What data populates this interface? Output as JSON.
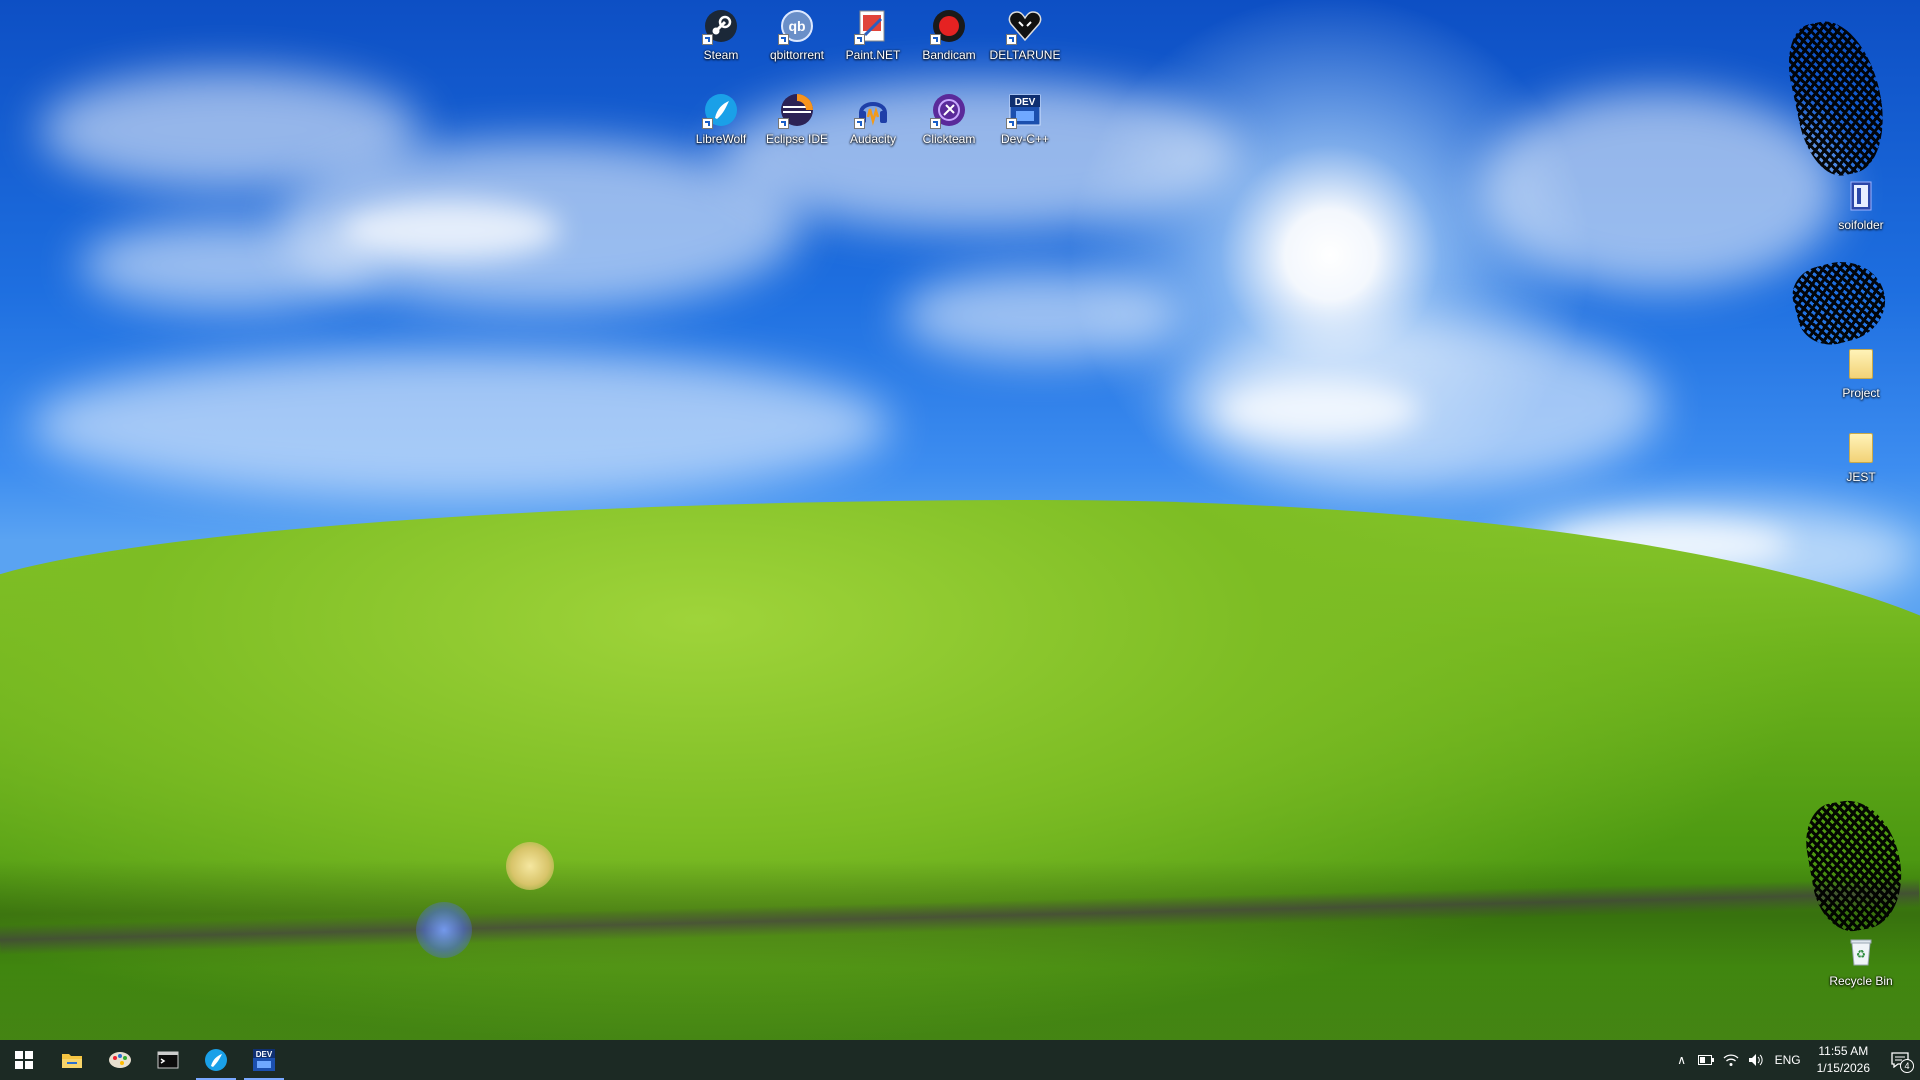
{
  "desktop": {
    "icons": [
      {
        "label": "Steam"
      },
      {
        "label": "qbittorrent"
      },
      {
        "label": "Paint.NET"
      },
      {
        "label": "Bandicam"
      },
      {
        "label": "DELTARUNE"
      },
      {
        "label": "LibreWolf"
      },
      {
        "label": "Eclipse IDE"
      },
      {
        "label": "Audacity"
      },
      {
        "label": "Clickteam"
      },
      {
        "label": "Dev-C++"
      }
    ],
    "right_icons": [
      {
        "label": "soifolder"
      },
      {
        "label": "Project"
      },
      {
        "label": "JEST"
      },
      {
        "label": "Recycle Bin"
      }
    ]
  },
  "taskbar": {
    "pinned": [
      {
        "icon": "windows-start-icon"
      },
      {
        "icon": "file-explorer-icon"
      },
      {
        "icon": "paint-palette-icon"
      },
      {
        "icon": "terminal-icon"
      },
      {
        "icon": "librewolf-icon",
        "active": true
      },
      {
        "icon": "dev-cpp-icon",
        "active": true
      }
    ],
    "tray": {
      "language": "ENG",
      "time": "11:55 AM",
      "date": "1/15/2026",
      "notification_count": "4"
    }
  },
  "colors": {
    "taskbar": "#1c2a24",
    "sky": "#1e6fe0",
    "grass": "#6db31c"
  }
}
